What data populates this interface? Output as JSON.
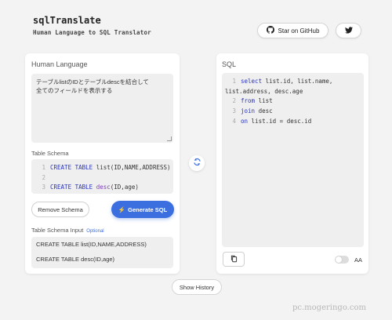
{
  "header": {
    "title": "sqlTranslate",
    "subtitle": "Human Language to SQL Translator",
    "github_label": "Star on GitHub",
    "github_icon": "github-icon",
    "twitter_icon": "twitter-icon"
  },
  "left": {
    "title": "Human Language",
    "input_text_line1": "テーブルlistのIDとテーブルdescを結合して",
    "input_text_line2": "全てのフィールドを表示する",
    "schema_label": "Table Schema",
    "schema_lines": [
      {
        "num": "1",
        "kw": "CREATE TABLE",
        "rest_pre": " list(ID,NAME,ADDRESS)",
        "fn": ""
      },
      {
        "num": "2",
        "kw": "",
        "rest_pre": "",
        "fn": ""
      },
      {
        "num": "3",
        "kw": "CREATE TABLE",
        "rest_pre": " ",
        "fn": "desc",
        "rest_post": "(ID,age)"
      }
    ],
    "remove_label": "Remove Schema",
    "generate_label": "Generate SQL",
    "generate_icon": "⚡",
    "schema_input_label": "Table Schema Input",
    "optional_label": "Optional",
    "schema_input_line1": "CREATE TABLE list(ID,NAME,ADDRESS)",
    "schema_input_line2": "CREATE TABLE desc(ID,age)"
  },
  "right": {
    "title": "SQL",
    "sql": {
      "l1_num": "1",
      "l1_kw": "select",
      "l1_rest": " list.id, list.name,",
      "l1b": "list.address, desc.age",
      "l2_num": "2",
      "l2_kw": "from",
      "l2_rest": " list",
      "l3_num": "3",
      "l3_kw": "join",
      "l3_rest": " desc",
      "l4_num": "4",
      "l4_kw": "on",
      "l4_rest": " list.id = desc.id"
    },
    "aa_label": "AA"
  },
  "footer": {
    "history_label": "Show History"
  },
  "watermark": "pc.mogeringo.com",
  "colors": {
    "accent": "#3b6fe0",
    "keyword": "#2b35b8",
    "background": "#f3f3f3"
  }
}
